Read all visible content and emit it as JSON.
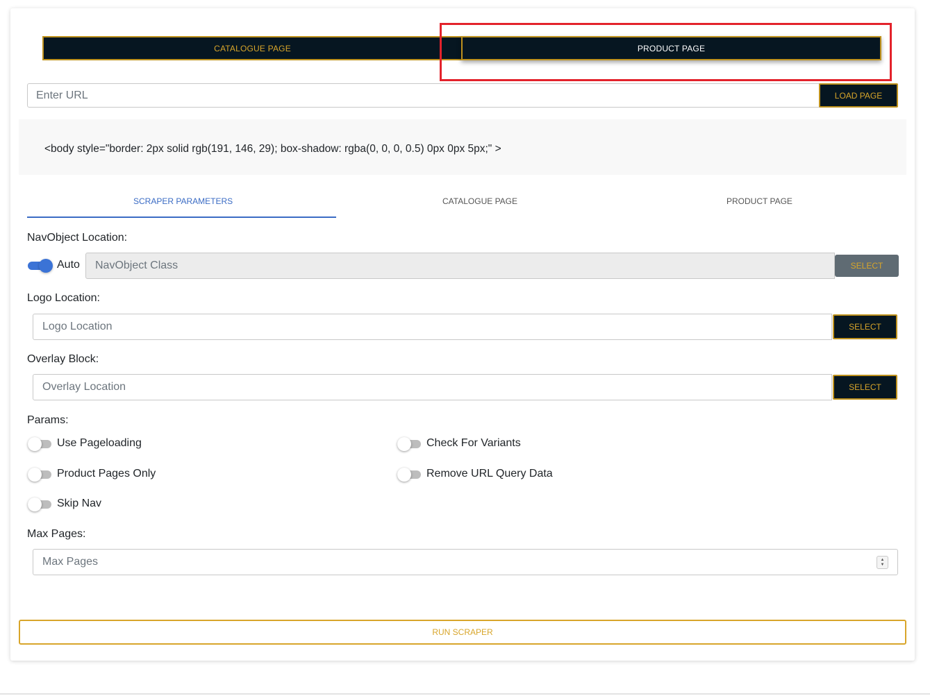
{
  "mode_toggle": {
    "catalogue_label": "CATALOGUE PAGE",
    "product_label": "PRODUCT PAGE"
  },
  "url_bar": {
    "placeholder": "Enter URL",
    "load_label": "LOAD PAGE"
  },
  "preview": {
    "code": "<body style=\"border: 2px solid rgb(191, 146, 29); box-shadow: rgba(0, 0, 0, 0.5) 0px 0px 5px;\" >"
  },
  "tabs": [
    {
      "label": "SCRAPER PARAMETERS",
      "active": true
    },
    {
      "label": "CATALOGUE PAGE",
      "active": false
    },
    {
      "label": "PRODUCT PAGE",
      "active": false
    }
  ],
  "nav_object": {
    "label": "NavObject Location:",
    "auto_label": "Auto",
    "auto_on": true,
    "placeholder": "NavObject Class",
    "select_label": "SELECT"
  },
  "logo": {
    "label": "Logo Location:",
    "placeholder": "Logo Location",
    "select_label": "SELECT"
  },
  "overlay": {
    "label": "Overlay Block:",
    "placeholder": "Overlay Location",
    "select_label": "SELECT"
  },
  "params": {
    "label": "Params:",
    "items": [
      {
        "label": "Use Pageloading",
        "on": false
      },
      {
        "label": "Check For Variants",
        "on": false
      },
      {
        "label": "Product Pages Only",
        "on": false
      },
      {
        "label": "Remove URL Query Data",
        "on": false
      },
      {
        "label": "Skip Nav",
        "on": false
      }
    ]
  },
  "max_pages": {
    "label": "Max Pages:",
    "placeholder": "Max Pages"
  },
  "run_label": "RUN SCRAPER",
  "colors": {
    "dark": "#061621",
    "gold": "#bf921d",
    "accent_blue": "#3a6bc4",
    "highlight_red": "#e3222b"
  }
}
